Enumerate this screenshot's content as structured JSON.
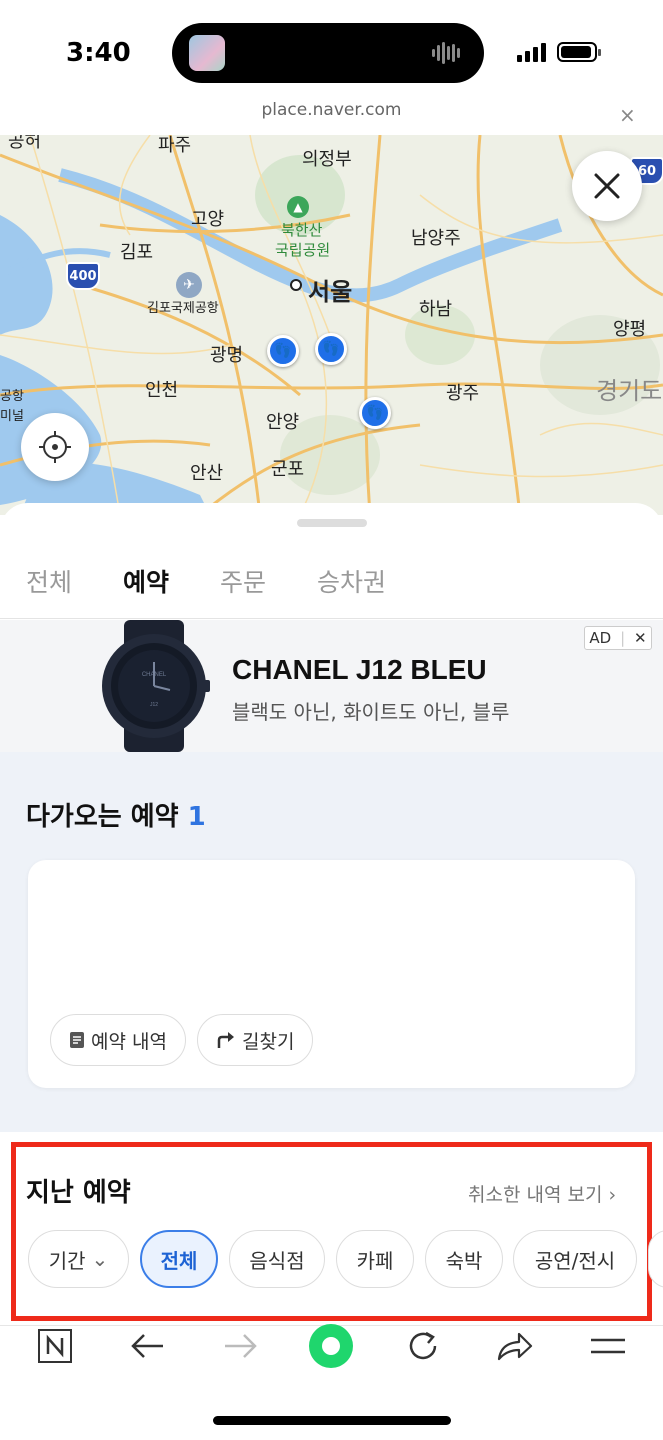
{
  "status": {
    "time": "3:40"
  },
  "browser": {
    "url": "place.naver.com",
    "close": "×"
  },
  "map": {
    "labels": {
      "paju": "파주",
      "uijeongbu": "의정부",
      "goyang": "고양",
      "bukhansan": "북한산",
      "park": "국립공원",
      "namyangju": "남양주",
      "gimpo": "김포",
      "seoul": "서울",
      "airport": "김포국제공항",
      "hanam": "하남",
      "yangpyeong": "양평",
      "gwangmyeong": "광명",
      "incheon": "인천",
      "gwangju": "광주",
      "gyeonggi": "경기도",
      "anyang": "안양",
      "ansan": "안산",
      "gunpo": "군포",
      "gonghang": "공항",
      "terminal": "미널",
      "top_left": "공허"
    },
    "shields": {
      "s400": "400",
      "s60": "60"
    }
  },
  "tabs": [
    {
      "label": "전체"
    },
    {
      "label": "예약"
    },
    {
      "label": "주문"
    },
    {
      "label": "승차권"
    }
  ],
  "ad": {
    "title": "CHANEL J12 BLEU",
    "subtitle": "블랙도 아닌, 화이트도 아닌, 블루",
    "badge": "AD",
    "watch_brand": "CHANEL",
    "watch_model": "J12"
  },
  "upcoming": {
    "title": "다가오는 예약",
    "count": "1",
    "history_button": "예약 내역",
    "directions_button": "길찾기"
  },
  "past": {
    "title": "지난 예약",
    "cancel_link": "취소한 내역 보기 ›",
    "filters": [
      "기간",
      "전체",
      "음식점",
      "카페",
      "숙박",
      "공연/전시"
    ]
  },
  "colors": {
    "accent": "#3b7ee8",
    "highlight": "#ee2a1a",
    "marker": "#1f6fe8"
  }
}
